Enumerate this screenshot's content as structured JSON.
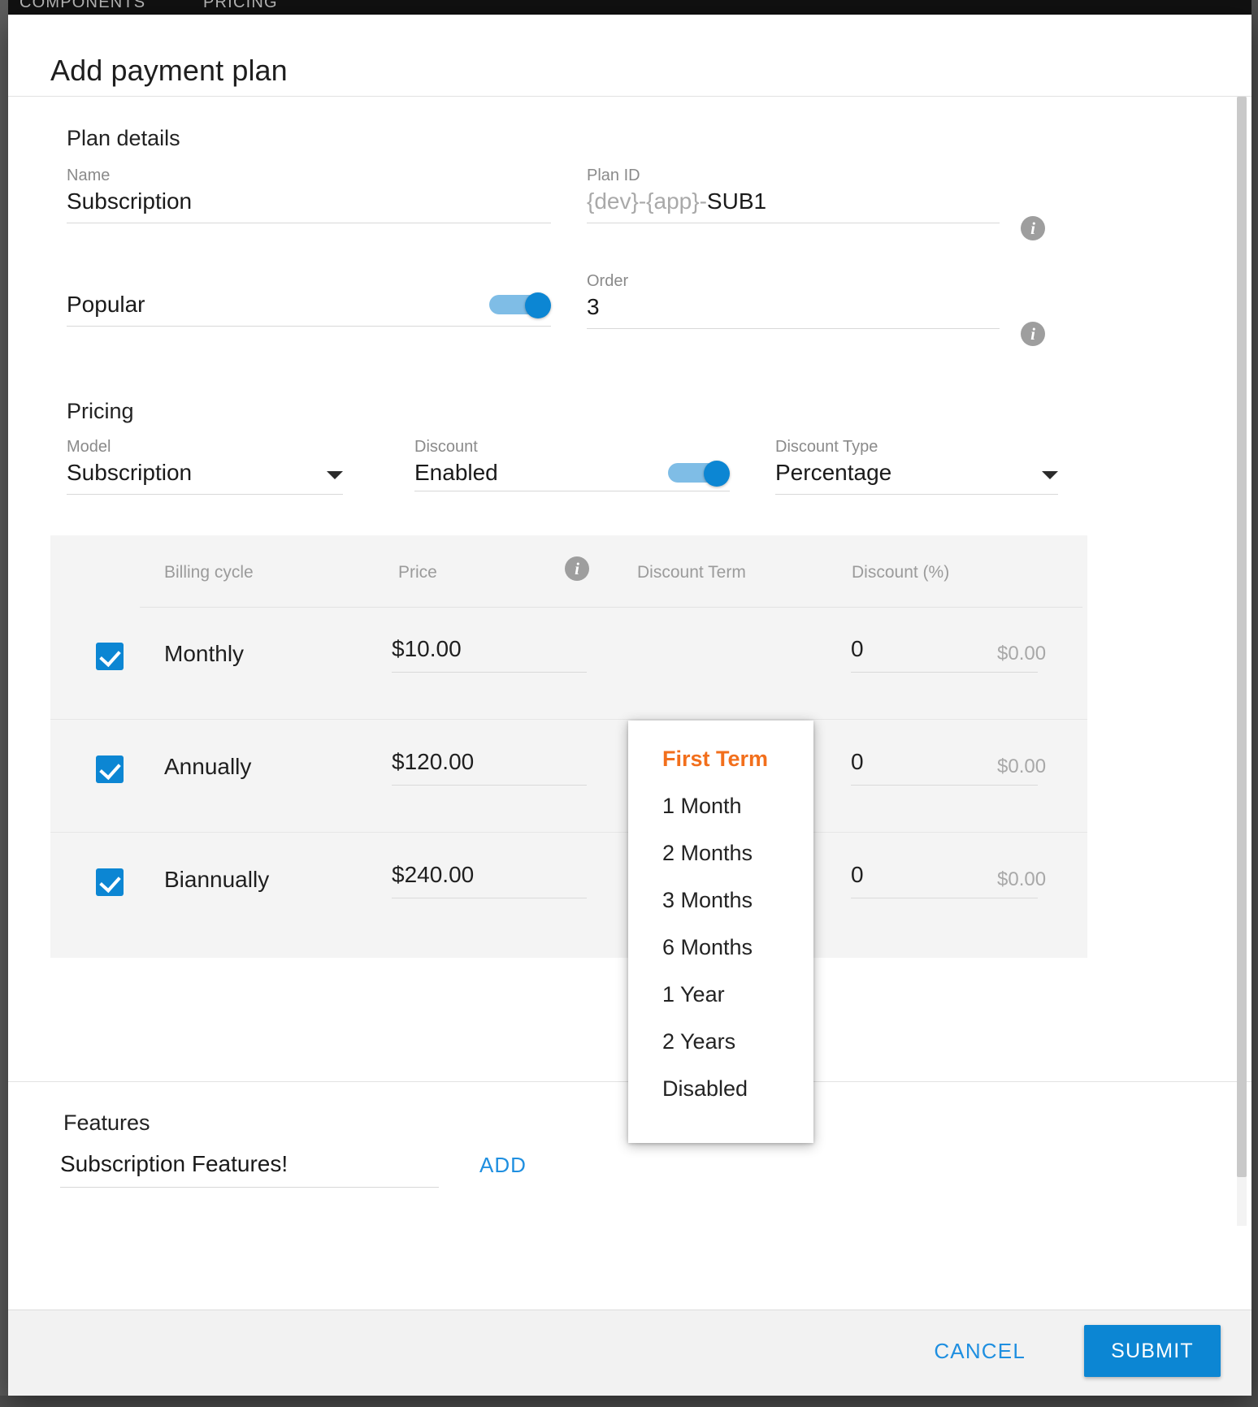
{
  "background": {
    "tabs": [
      "COMPONENTS",
      "PRICING"
    ]
  },
  "dialog": {
    "title": "Add payment plan",
    "sections": {
      "plan_details": {
        "heading": "Plan details",
        "name": {
          "label": "Name",
          "value": "Subscription"
        },
        "plan_id": {
          "label": "Plan ID",
          "prefix": "{dev}-{app}-",
          "value": "SUB1",
          "info_icon": "info-icon"
        },
        "popular": {
          "label": "Popular",
          "enabled": true
        },
        "order": {
          "label": "Order",
          "value": "3",
          "info_icon": "info-icon"
        }
      },
      "pricing": {
        "heading": "Pricing",
        "model": {
          "label": "Model",
          "value": "Subscription"
        },
        "discount": {
          "label": "Discount",
          "value": "Enabled",
          "enabled": true
        },
        "discount_type": {
          "label": "Discount Type",
          "value": "Percentage"
        },
        "table": {
          "columns": [
            "Billing cycle",
            "Price",
            "Discount Term",
            "Discount (%)"
          ],
          "price_info_icon": "info-icon",
          "rows": [
            {
              "checked": true,
              "cycle": "Monthly",
              "price": "$10.00",
              "discount": "0",
              "discount_amount": "$0.00"
            },
            {
              "checked": true,
              "cycle": "Annually",
              "price": "$120.00",
              "discount": "0",
              "discount_amount": "$0.00"
            },
            {
              "checked": true,
              "cycle": "Biannually",
              "price": "$240.00",
              "discount": "0",
              "discount_amount": "$0.00"
            }
          ]
        }
      },
      "features": {
        "heading": "Features",
        "input_value": "Subscription Features!",
        "add_label": "ADD"
      }
    },
    "dropdown": {
      "name": "discount-term-dropdown",
      "selected": "First Term",
      "selected_color": "#f26f1c",
      "items": [
        "First Term",
        "1 Month",
        "2 Months",
        "3 Months",
        "6 Months",
        "1 Year",
        "2 Years",
        "Disabled"
      ]
    },
    "footer": {
      "cancel_label": "CANCEL",
      "submit_label": "SUBMIT"
    }
  },
  "colors": {
    "accent": "#0c86d3",
    "accent_light": "#7fbde6",
    "link": "#1f8fe0",
    "highlight": "#f26f1c",
    "table_bg": "#f4f4f4"
  }
}
